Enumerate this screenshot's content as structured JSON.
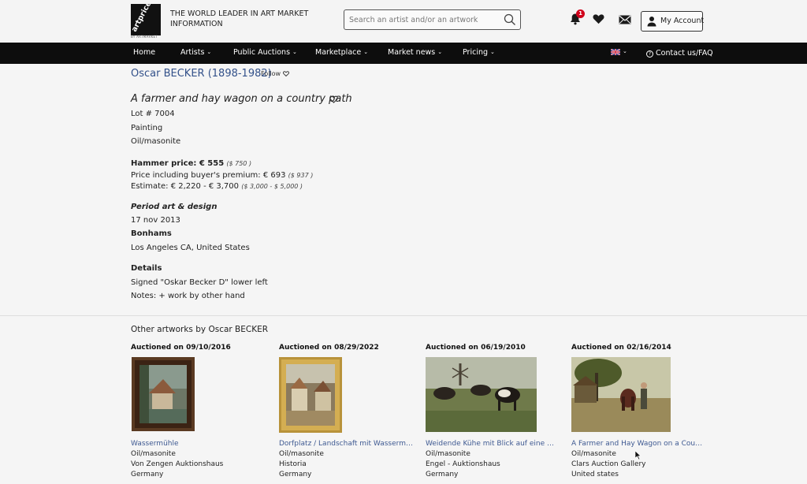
{
  "header": {
    "logo_text": "artprice.com",
    "logo_sub": "BY ARTMARKET",
    "tagline": "THE WORLD LEADER IN ART MARKET INFORMATION",
    "search_placeholder": "Search an artist and/or an artwork",
    "notification_count": "1",
    "account_label": "My Account"
  },
  "nav": {
    "items": [
      {
        "label": "Home",
        "has_dropdown": false
      },
      {
        "label": "Artists",
        "has_dropdown": true
      },
      {
        "label": "Public Auctions",
        "has_dropdown": true
      },
      {
        "label": "Marketplace",
        "has_dropdown": true
      },
      {
        "label": "Market news",
        "has_dropdown": true
      },
      {
        "label": "Pricing",
        "has_dropdown": true
      }
    ],
    "contact_label": "Contact us/FAQ"
  },
  "lot": {
    "artist": "Oscar BECKER (1898-1982)",
    "follow_label": "Follow",
    "title": "A farmer and hay wagon on a country path",
    "lot_number": "Lot # 7004",
    "category": "Painting",
    "medium": "Oil/masonite",
    "hammer_label": "Hammer price: € 555",
    "hammer_usd": "($ 750 )",
    "premium_label": "Price including buyer's premium: € 693",
    "premium_usd": "($ 937 )",
    "estimate_label": "Estimate: € 2,220 - € 3,700",
    "estimate_usd": "($ 3,000 - $ 5,000 )",
    "sale_name": "Period art & design",
    "sale_date": "17 nov 2013",
    "auction_house": "Bonhams",
    "location": "Los Angeles CA, United States",
    "details_heading": "Details",
    "signature": "Signed \"Oskar Becker D\" lower left",
    "notes": "Notes: + work by other hand"
  },
  "other": {
    "heading": "Other artworks by Oscar BECKER",
    "cards": [
      {
        "date": "Auctioned on 09/10/2016",
        "title": "Wassermühle",
        "medium": "Oil/masonite",
        "house": "Von Zengen Auktionshaus",
        "country": "Germany"
      },
      {
        "date": "Auctioned on 08/29/2022",
        "title": "Dorfplatz / Landschaft mit Wassermühle",
        "medium": "Oil/masonite",
        "house": "Historia",
        "country": "Germany"
      },
      {
        "date": "Auctioned on 06/19/2010",
        "title": "Weidende Kühe mit Blick auf eine Win...",
        "medium": "Oil/masonite",
        "house": "Engel - Auktionshaus",
        "country": "Germany"
      },
      {
        "date": "Auctioned on 02/16/2014",
        "title": "A Farmer and Hay Wagon on a Countr...",
        "medium": "Oil/masonite",
        "house": "Clars Auction Gallery",
        "country": "United states"
      }
    ]
  },
  "colors": {
    "nav_bg": "#0d0d0d",
    "link": "#33518a",
    "badge": "#d0021b"
  }
}
